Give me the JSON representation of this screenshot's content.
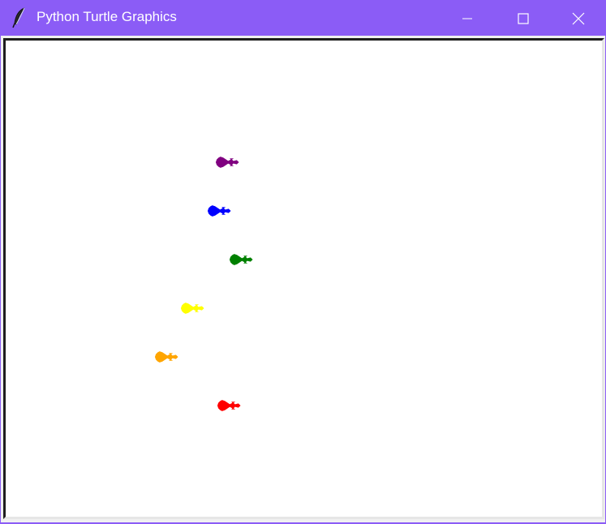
{
  "window": {
    "title": "Python Turtle Graphics",
    "titlebar_color": "#8b5cf6",
    "app_icon": "feather-icon"
  },
  "controls": {
    "minimize_icon": "minimize-icon",
    "maximize_icon": "maximize-icon",
    "close_icon": "close-icon"
  },
  "canvas": {
    "background": "#ffffff"
  },
  "turtles": [
    {
      "name": "turtle-purple",
      "color": "purple"
    },
    {
      "name": "turtle-blue",
      "color": "blue"
    },
    {
      "name": "turtle-green",
      "color": "green"
    },
    {
      "name": "turtle-yellow",
      "color": "yellow"
    },
    {
      "name": "turtle-orange",
      "color": "orange"
    },
    {
      "name": "turtle-red",
      "color": "red"
    }
  ]
}
